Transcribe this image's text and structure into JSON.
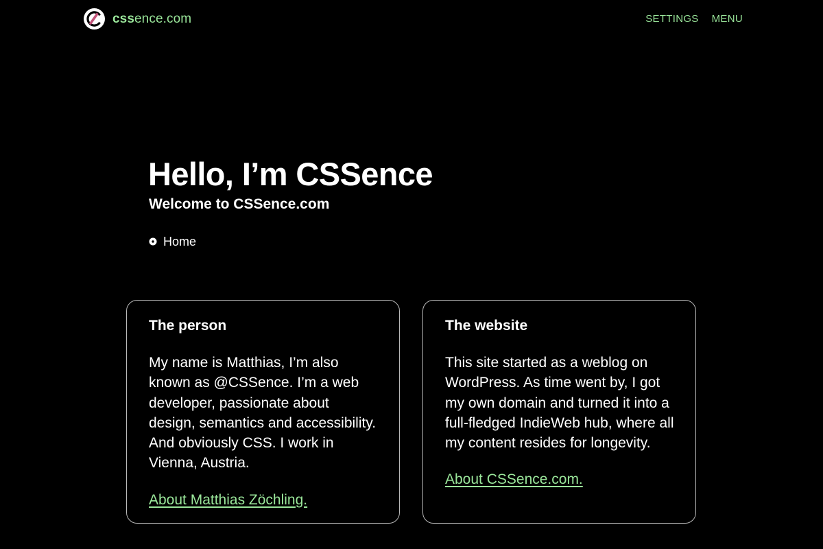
{
  "header": {
    "logo": {
      "text_bold": "css",
      "text_rest": "ence.com",
      "icon": "cssence-logo-icon"
    },
    "nav": [
      {
        "label": "SETTINGS"
      },
      {
        "label": "MENU"
      }
    ]
  },
  "hero": {
    "title": "Hello, I’m CSSence",
    "subtitle": "Welcome to CSSence.com"
  },
  "breadcrumb": {
    "icon": "bullet-icon",
    "label": "Home"
  },
  "cards": [
    {
      "title": "The person",
      "body": "My name is Matthias, I’m also known as @CSSence. I’m a web developer, passionate about design, semantics and accessibility. And obviously CSS. I work in Vienna, Austria.",
      "link": "About Matthias Zöchling."
    },
    {
      "title": "The website",
      "body": "This site started as a weblog on WordPress. As time went by, I got my own domain and turned it into a full-fledged IndieWeb hub, where all my content resides for longevity.",
      "link": "About CSSence.com."
    }
  ],
  "colors": {
    "background": "#000000",
    "text": "#ffffff",
    "accent": "#9ae69a",
    "logo_stripe": "#c2547a",
    "card_border": "#b8b8b8"
  }
}
